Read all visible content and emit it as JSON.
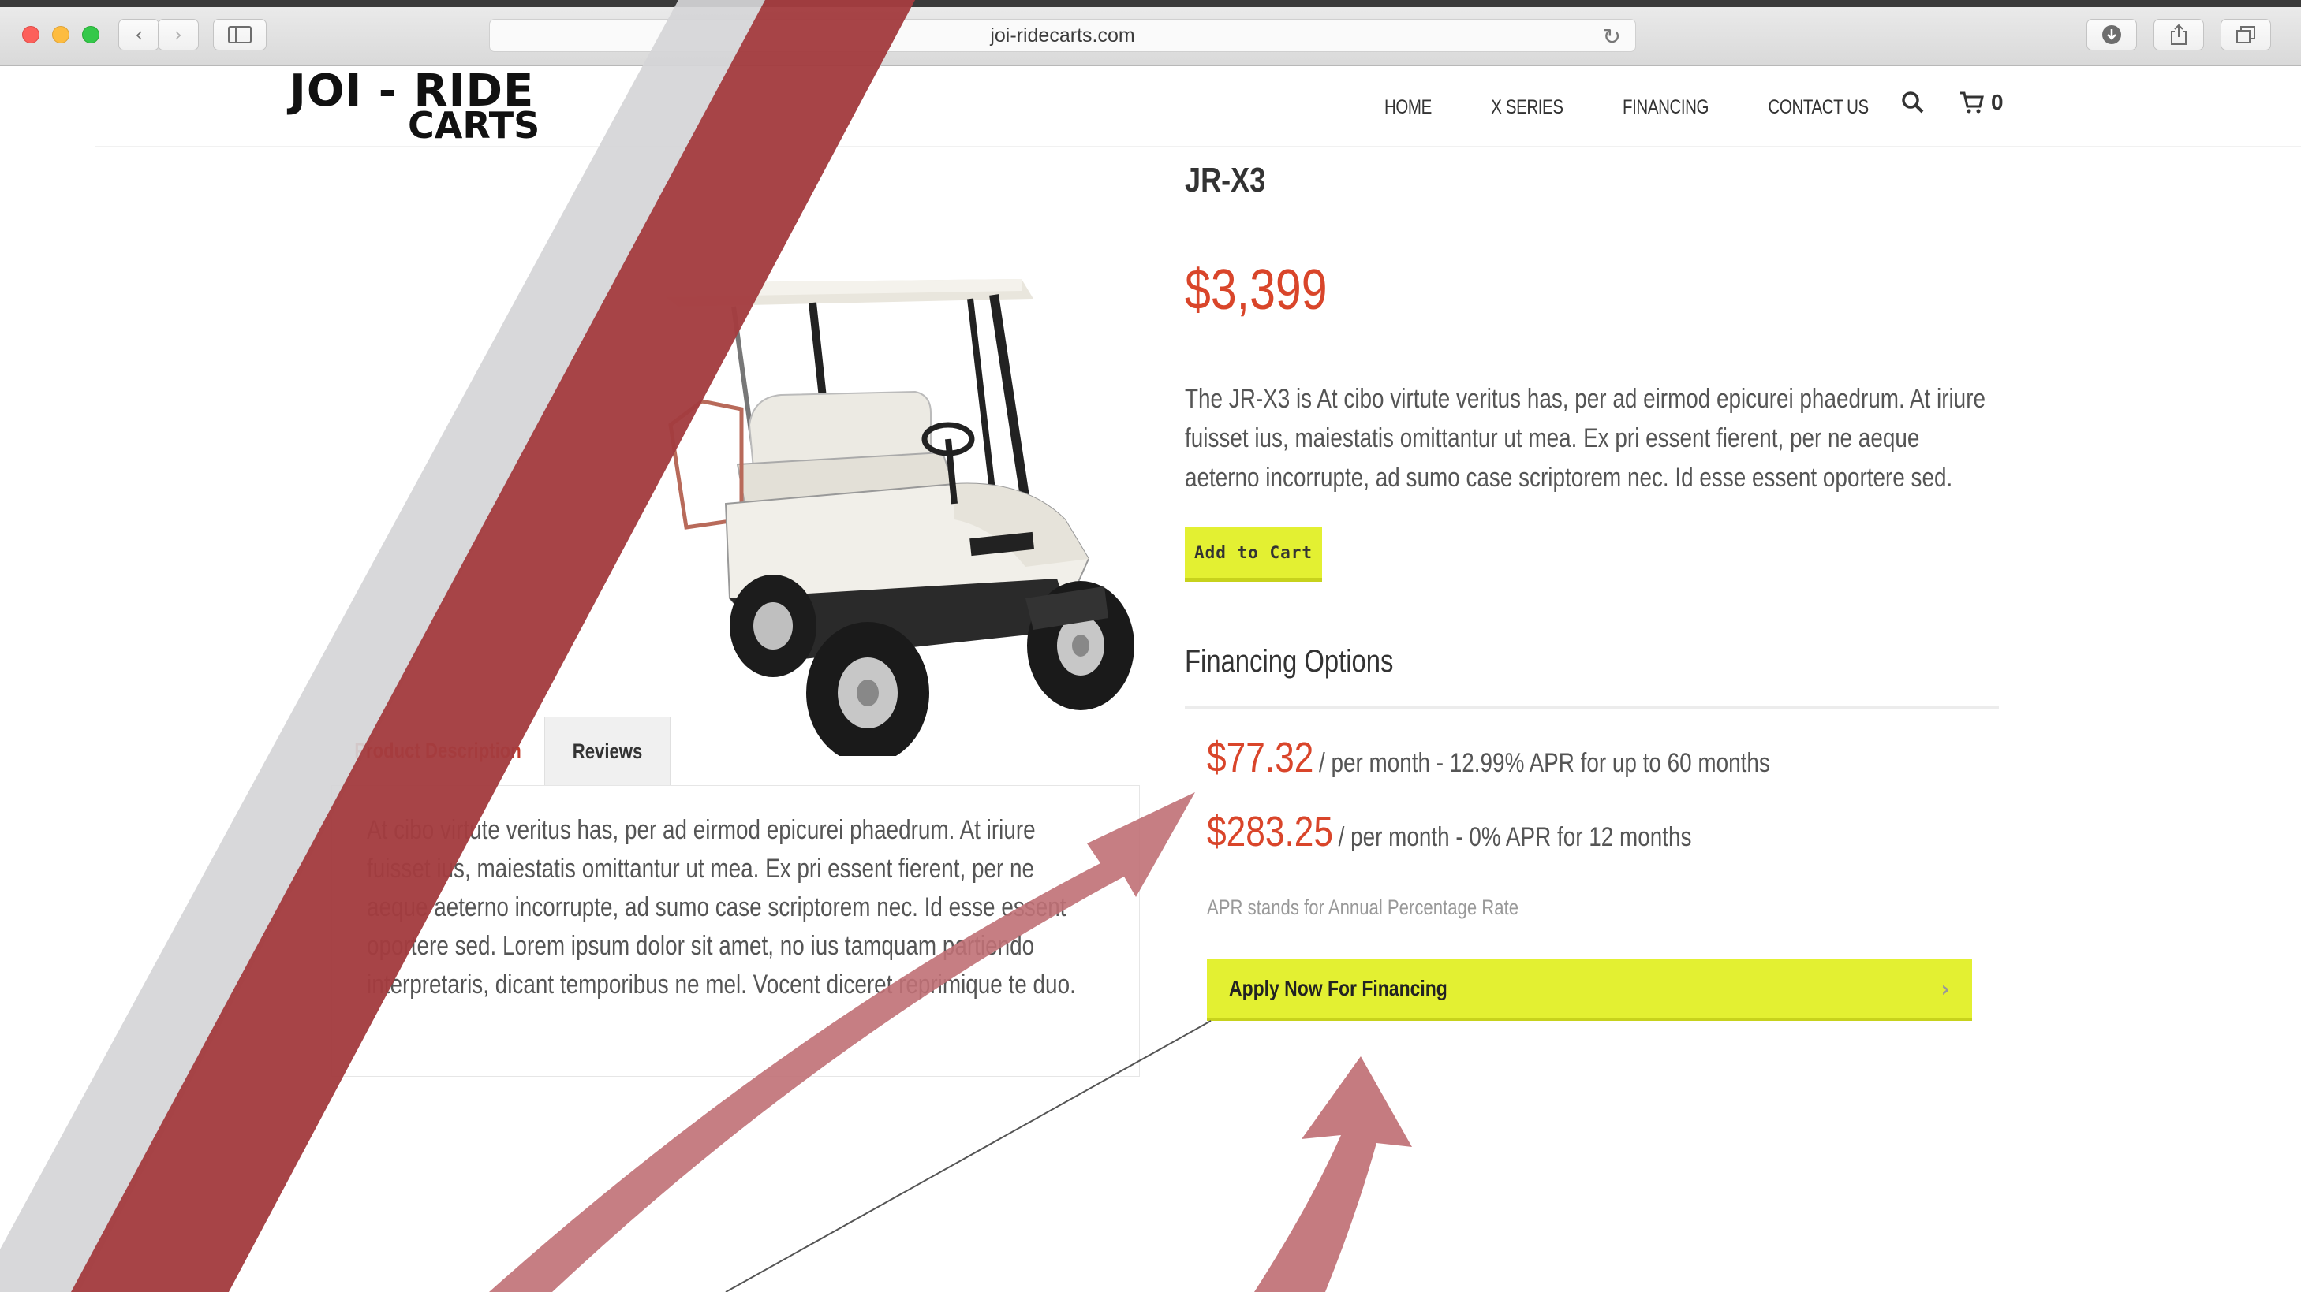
{
  "browser": {
    "url": "joi-ridecarts.com",
    "icons": {
      "back": "chevron-left-icon",
      "forward": "chevron-right-icon",
      "sidebar": "sidebar-icon",
      "reload": "reload-icon",
      "download": "download-icon",
      "share": "share-icon",
      "tabs": "tabs-icon"
    }
  },
  "logo": {
    "line1": "JOI - RIDE",
    "line2": "CARTS"
  },
  "nav": {
    "items": [
      "HOME",
      "X SERIES",
      "FINANCING",
      "CONTACT US"
    ],
    "cart_count": "0"
  },
  "product": {
    "title": "JR-X3",
    "price": "$3,399",
    "description": "The JR-X3 is At cibo virtute veritus has, per ad eirmod epicurei phaedrum. At iriure fuisset ius, maiestatis omittantur ut mea. Ex pri essent fierent, per ne aeque aeterno incorrupte, ad sumo case scriptorem nec. Id esse essent oportere sed.",
    "add_to_cart": "Add to Cart"
  },
  "tabs": {
    "product_description": "Product Description",
    "reviews": "Reviews",
    "content": "At cibo virtute veritus has, per ad eirmod epicurei phaedrum. At iriure fuisset ius, maiestatis omittantur ut mea. Ex pri essent fierent, per ne aeque aeterno incorrupte, ad sumo case scriptorem nec. Id esse essent oportere sed.  Lorem ipsum dolor sit amet, no ius tamquam partiendo interpretaris, dicant temporibus ne mel. Vocent diceret reprimique te duo."
  },
  "financing": {
    "title": "Financing Options",
    "options": [
      {
        "amount": "$77.32",
        "text": "/ per month - 12.99% APR for up to 60 months"
      },
      {
        "amount": "$283.25",
        "text": "/ per month - 0% APR for 12 months"
      }
    ],
    "note": "APR stands for Annual Percentage Rate",
    "apply_label": "Apply Now For Financing"
  },
  "colors": {
    "accent_red": "#d9452a",
    "button_yellow": "#e3f032",
    "overlay_dark_red": "#a33c40",
    "overlay_arrow": "#c07075",
    "overlay_grey": "#d5d5d7"
  }
}
